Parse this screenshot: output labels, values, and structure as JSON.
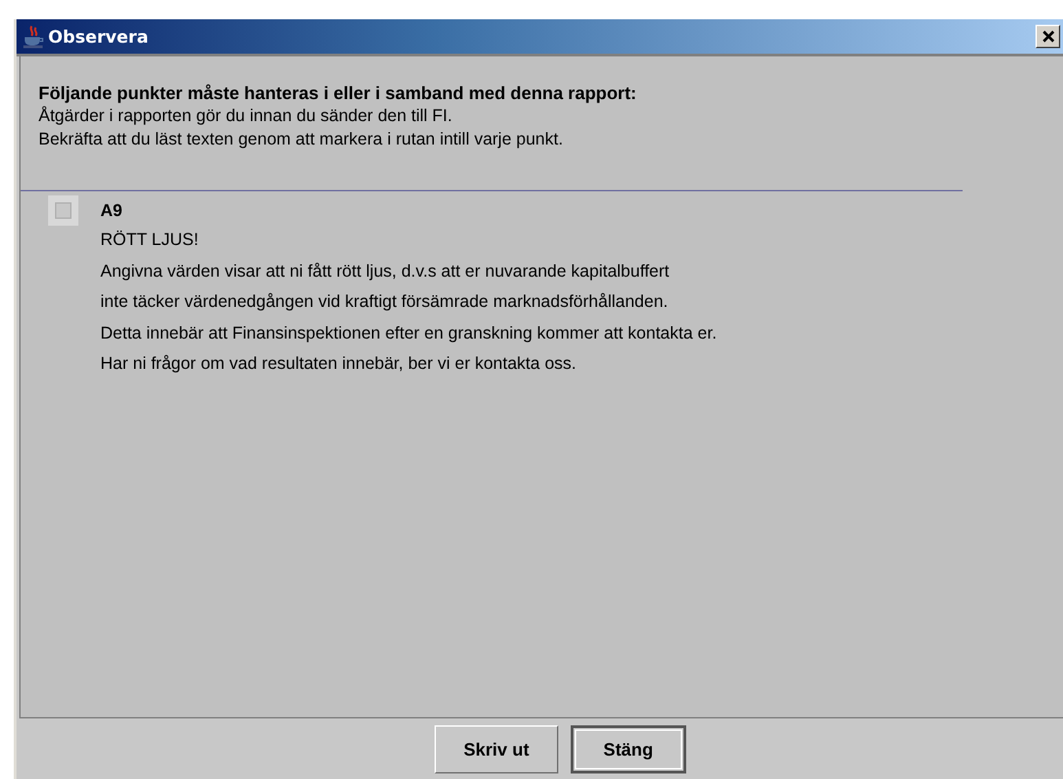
{
  "window": {
    "title": "Observera"
  },
  "intro": {
    "heading": "Följande punkter måste hanteras i eller i samband med denna rapport:",
    "lines": [
      "Åtgärder i rapporten gör du innan du sänder den till FI.",
      "Bekräfta att du läst texten genom att markera i rutan intill varje punkt."
    ]
  },
  "items": [
    {
      "code": "A9",
      "checked": false,
      "lines": [
        "RÖTT LJUS!",
        "Angivna värden visar att ni fått rött ljus, d.v.s att er nuvarande kapitalbuffert",
        "inte täcker värdenedgången vid kraftigt försämrade marknadsförhållanden.",
        "Detta innebär att Finansinspektionen efter en granskning kommer att kontakta er.",
        "Har ni frågor om vad resultaten innebär, ber vi er kontakta oss."
      ]
    }
  ],
  "buttons": [
    {
      "label": "Skriv ut",
      "focused": false
    },
    {
      "label": "Stäng",
      "focused": true
    }
  ]
}
